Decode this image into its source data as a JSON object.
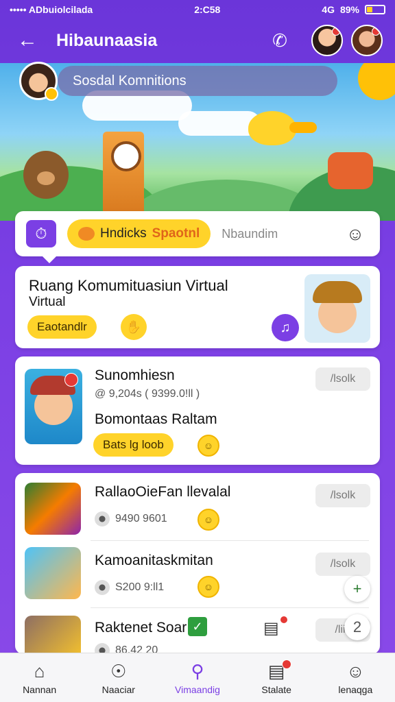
{
  "status_bar": {
    "carrier": "••••• ADbuiolcilada",
    "signal": "4G",
    "time": "2:C58",
    "battery": "89%"
  },
  "header": {
    "title": "Hibaunaasia",
    "back_icon": "arrow-left-icon",
    "phone_icon": "phone-icon"
  },
  "hero": {
    "community_label": "Sosdal Komnitions"
  },
  "tabs": {
    "active_t1": "Hndicks",
    "active_t2": "Spaotnl",
    "inactive": "Nbaundim"
  },
  "featured": {
    "title": "Ruang Komumituasiun Virtual",
    "subtitle": "Virtual",
    "button": "Eaotandlr"
  },
  "items": [
    {
      "title": "Sunomhiesn",
      "meta": "@ 9,204s ( 9399.0!ll )",
      "subtitle": "Bomontaas Raltam",
      "button": "Bats lg loob",
      "action": "/lsolk"
    },
    {
      "title": "RallaoOieFan llevalal",
      "meta": "9490 9601",
      "action": "/lsolk"
    },
    {
      "title": "Kamoanitaskmitan",
      "meta": "S200 9:ll1",
      "action": "/lsolk"
    },
    {
      "title": "Raktenet Soar",
      "meta": "86,42 20",
      "action": "/liik",
      "fab_text": "2"
    }
  ],
  "nav": [
    {
      "label": "Nannan",
      "icon": "home-icon"
    },
    {
      "label": "Naaciar",
      "icon": "compass-icon"
    },
    {
      "label": "Vimaandig",
      "icon": "search-icon"
    },
    {
      "label": "Stalate",
      "icon": "chat-icon"
    },
    {
      "label": "lenaqga",
      "icon": "user-icon"
    }
  ],
  "colors": {
    "primary": "#7b3fe4",
    "accent": "#ffd32a",
    "badge": "#e53935"
  }
}
